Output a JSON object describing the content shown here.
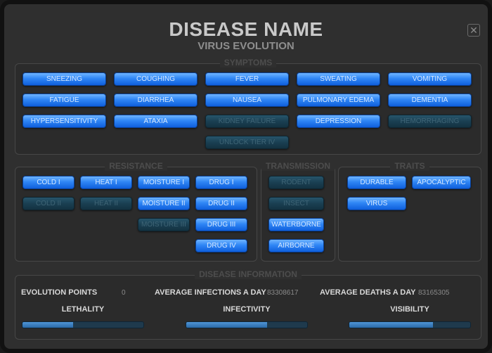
{
  "header": {
    "title": "DISEASE NAME",
    "subtitle": "VIRUS EVOLUTION",
    "close_label": "✕"
  },
  "sections": {
    "symptoms": "SYMPTOMS",
    "resistance": "RESISTANCE",
    "transmission": "TRANSMISSION",
    "traits": "TRAITS",
    "disease_information": "DISEASE INFORMATION"
  },
  "symptoms": [
    {
      "label": "SNEEZING",
      "locked": false
    },
    {
      "label": "COUGHING",
      "locked": false
    },
    {
      "label": "FEVER",
      "locked": false
    },
    {
      "label": "SWEATING",
      "locked": false
    },
    {
      "label": "VOMITING",
      "locked": false
    },
    {
      "label": "FATIGUE",
      "locked": false
    },
    {
      "label": "DIARRHEA",
      "locked": false
    },
    {
      "label": "NAUSEA",
      "locked": false
    },
    {
      "label": "PULMONARY EDEMA",
      "locked": false
    },
    {
      "label": "DEMENTIA",
      "locked": false
    },
    {
      "label": "HYPERSENSITIVITY",
      "locked": false
    },
    {
      "label": "ATAXIA",
      "locked": false
    },
    {
      "label": "KIDNEY FAILURE",
      "locked": true
    },
    {
      "label": "DEPRESSION",
      "locked": false
    },
    {
      "label": "HEMORRHAGING",
      "locked": true
    },
    {
      "label": "UNLOCK TIER IV",
      "locked": true
    }
  ],
  "resistance": [
    {
      "label": "COLD I",
      "locked": false
    },
    {
      "label": "HEAT I",
      "locked": false
    },
    {
      "label": "MOISTURE I",
      "locked": false
    },
    {
      "label": "DRUG I",
      "locked": false
    },
    {
      "label": "COLD II",
      "locked": true
    },
    {
      "label": "HEAT II",
      "locked": true
    },
    {
      "label": "MOISTURE II",
      "locked": false
    },
    {
      "label": "DRUG II",
      "locked": false
    },
    {
      "label": "MOISTURE III",
      "locked": true
    },
    {
      "label": "DRUG III",
      "locked": false
    },
    {
      "label": "DRUG IV",
      "locked": false
    }
  ],
  "transmission": [
    {
      "label": "RODENT",
      "locked": true
    },
    {
      "label": "INSECT",
      "locked": true
    },
    {
      "label": "WATERBORNE",
      "locked": false
    },
    {
      "label": "AIRBORNE",
      "locked": false
    }
  ],
  "traits": [
    {
      "label": "DURABLE",
      "locked": false
    },
    {
      "label": "APOCALYPTIC",
      "locked": false
    },
    {
      "label": "VIRUS",
      "locked": false
    }
  ],
  "info": {
    "evolution_points_label": "EVOLUTION POINTS",
    "evolution_points": "0",
    "avg_infections_label": "AVERAGE INFECTIONS A DAY",
    "avg_infections": "83308617",
    "avg_deaths_label": "AVERAGE DEATHS A DAY",
    "avg_deaths": "83165305",
    "lethality_label": "LETHALITY",
    "lethality": 0.42,
    "infectivity_label": "INFECTIVITY",
    "infectivity": 0.67,
    "visibility_label": "VISIBILITY",
    "visibility": 0.69
  },
  "colors": {
    "button_active": "#2f86f5",
    "button_locked": "#1a3f52",
    "bar_fill": "#3b7fc0"
  }
}
